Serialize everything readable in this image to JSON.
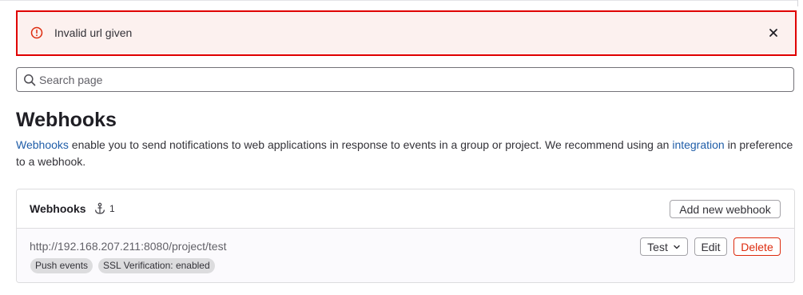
{
  "alert": {
    "message": "Invalid url given",
    "icon": "error-icon",
    "close_icon": "close-icon",
    "border_color": "#e00000",
    "background_color": "#fcf1ef"
  },
  "search": {
    "placeholder": "Search page",
    "value": ""
  },
  "page": {
    "title": "Webhooks",
    "description": {
      "link1": "Webhooks",
      "text1": " enable you to send notifications to web applications in response to events in a group or project. We recommend using an ",
      "link2": "integration",
      "text2": " in preference to a webhook."
    }
  },
  "card": {
    "title": "Webhooks",
    "count_icon": "anchor-icon",
    "count": "1",
    "add_button": "Add new webhook",
    "hooks": [
      {
        "url": "http://192.168.207.211:8080/project/test",
        "badges": [
          "Push events",
          "SSL Verification: enabled"
        ],
        "test_label": "Test",
        "edit_label": "Edit",
        "delete_label": "Delete"
      }
    ]
  },
  "colors": {
    "link": "#1f5da8",
    "danger": "#dd2b0e"
  }
}
